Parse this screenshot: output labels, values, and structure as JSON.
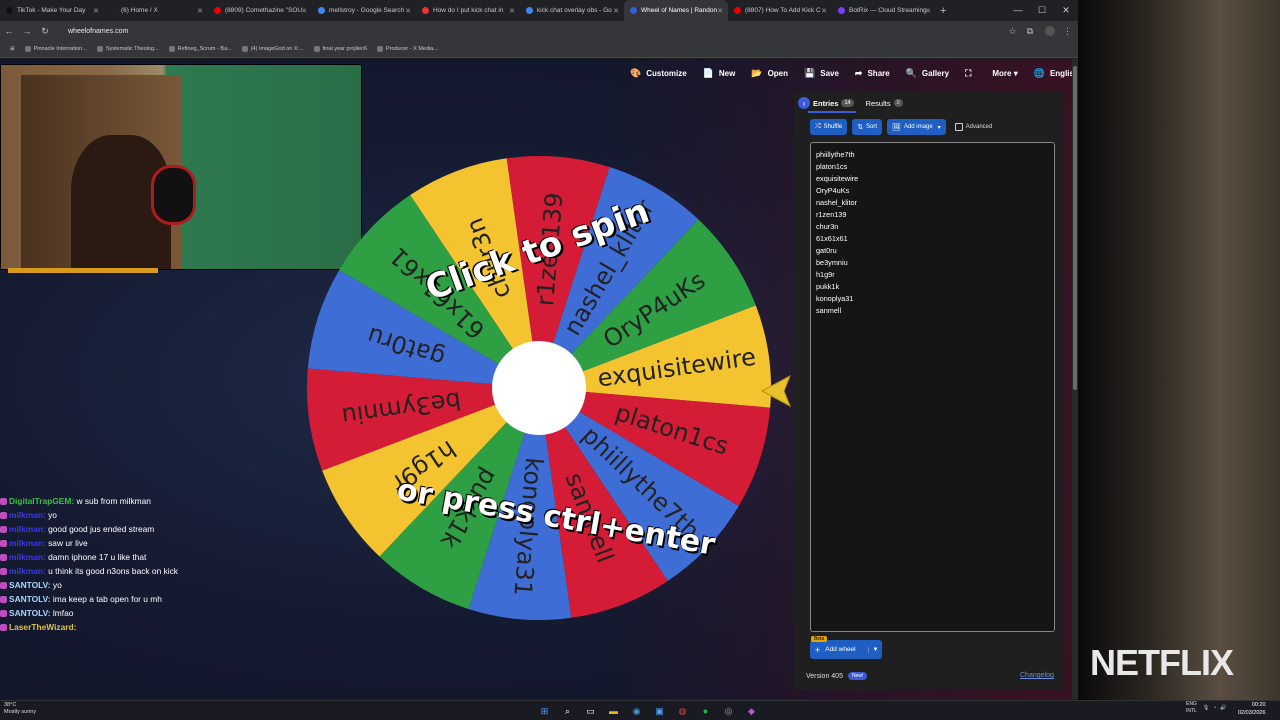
{
  "browser": {
    "tabs": [
      {
        "label": "TikTok - Make Your Day",
        "color": "#111"
      },
      {
        "label": "(6) Home / X",
        "color": "#222"
      },
      {
        "label": "(8809) Comethazine \"SOU",
        "color": "#e00"
      },
      {
        "label": "mellstroy - Google Search",
        "color": "#4285f4"
      },
      {
        "label": "How do I put kick chat in",
        "color": "#e33"
      },
      {
        "label": "kick chat overlay obs - Go",
        "color": "#4285f4"
      },
      {
        "label": "Wheel of Names | Randon",
        "color": "#3b5bdb",
        "active": true
      },
      {
        "label": "(8807) How To Add Kick C",
        "color": "#e00"
      },
      {
        "label": "BotRix — Cloud Streaming",
        "color": "#7a3cff"
      }
    ],
    "url": "wheelofnames.com",
    "bookmarks": [
      "Pinnacle Internation...",
      "Systematic Theolog...",
      "Refineg_Scrum - Ba...",
      "(4) ImageGod on X:...",
      "final year projilec6",
      "Producer - X Media..."
    ]
  },
  "toolbar": {
    "items": [
      {
        "icon": "palette-icon",
        "glyph": "🎨",
        "label": "Customize"
      },
      {
        "icon": "new-file-icon",
        "glyph": "📄",
        "label": "New"
      },
      {
        "icon": "folder-icon",
        "glyph": "📂",
        "label": "Open"
      },
      {
        "icon": "save-icon",
        "glyph": "💾",
        "label": "Save"
      },
      {
        "icon": "share-icon",
        "glyph": "➦",
        "label": "Share"
      },
      {
        "icon": "search-icon",
        "glyph": "🔍",
        "label": "Gallery"
      },
      {
        "icon": "fullscreen-icon",
        "glyph": "⛶",
        "label": ""
      },
      {
        "icon": "more-icon",
        "glyph": "",
        "label": "More ▾"
      },
      {
        "icon": "globe-icon",
        "glyph": "🌐",
        "label": "English"
      }
    ]
  },
  "wheel": {
    "segments": [
      {
        "name": "exquisitewire",
        "color": "#f4c430"
      },
      {
        "name": "platon1cs",
        "color": "#d41c36"
      },
      {
        "name": "phiillythe7th",
        "color": "#3f6dd6"
      },
      {
        "name": "sanmell",
        "color": "#d41c36"
      },
      {
        "name": "konoplya31",
        "color": "#3f6dd6"
      },
      {
        "name": "pukk1k",
        "color": "#2ea043"
      },
      {
        "name": "h1g9r",
        "color": "#f4c430"
      },
      {
        "name": "be3ymniu",
        "color": "#d41c36"
      },
      {
        "name": "gat0ru",
        "color": "#3f6dd6"
      },
      {
        "name": "61x61x61",
        "color": "#2ea043"
      },
      {
        "name": "chur3n",
        "color": "#f4c430"
      },
      {
        "name": "r1zen139",
        "color": "#d41c36"
      },
      {
        "name": "nashel_klitor",
        "color": "#3f6dd6"
      },
      {
        "name": "OryP4uKs",
        "color": "#2ea043"
      }
    ],
    "overlay_top": "Click to spin",
    "overlay_bottom": "or press ctrl+enter"
  },
  "panel": {
    "entries_tab": "Entries",
    "entries_count": "14",
    "results_tab": "Results",
    "results_count": "0",
    "buttons": {
      "shuffle": "Shuffle",
      "sort": "Sort",
      "add_image": "Add image"
    },
    "advanced": "Advanced",
    "entries": [
      "phiillythe7th",
      "platon1cs",
      "exquisitewire",
      "OryP4uKs",
      "nashel_klitor",
      "r1zen139",
      "chur3n",
      "61x61x61",
      "gat0ru",
      "be3ymniu",
      "h1g9r",
      "pukk1k",
      "konoplya31",
      "sanmell"
    ],
    "beta": "Beta",
    "add_wheel": "Add wheel",
    "version": "Version 405",
    "new_badge": "New!",
    "changelog": "Changelog"
  },
  "chat": [
    {
      "user": "DigitalTrapGEM:",
      "color": "#3fbf3f",
      "text": "w sub from milkman"
    },
    {
      "user": "milkman:",
      "color": "#3a3ae0",
      "text": "yo"
    },
    {
      "user": "milkman:",
      "color": "#3a3ae0",
      "text": "good good jus ended stream"
    },
    {
      "user": "milkman:",
      "color": "#3a3ae0",
      "text": "saw ur live"
    },
    {
      "user": "milkman:",
      "color": "#3a3ae0",
      "text": "damn iphone 17 u like that"
    },
    {
      "user": "milkman:",
      "color": "#3a3ae0",
      "text": "u think its good n3ons back on kick"
    },
    {
      "user": "SANTOLV:",
      "color": "#a8d8ff",
      "text": "yo"
    },
    {
      "user": "SANTOLV:",
      "color": "#a8d8ff",
      "text": "ima keep a tab open for u mh"
    },
    {
      "user": "SANTOLV:",
      "color": "#a8d8ff",
      "text": "lmfao"
    },
    {
      "user": "LaserTheWizard:",
      "color": "#e2c044",
      "text": ""
    }
  ],
  "overlay": {
    "brand": "NETFLIX"
  },
  "taskbar": {
    "weather_temp": "38°C",
    "weather_desc": "Mostly sunny",
    "lang_top": "ENG",
    "lang_bottom": "INTL",
    "time": "00:20",
    "date": "02/03/2026"
  }
}
